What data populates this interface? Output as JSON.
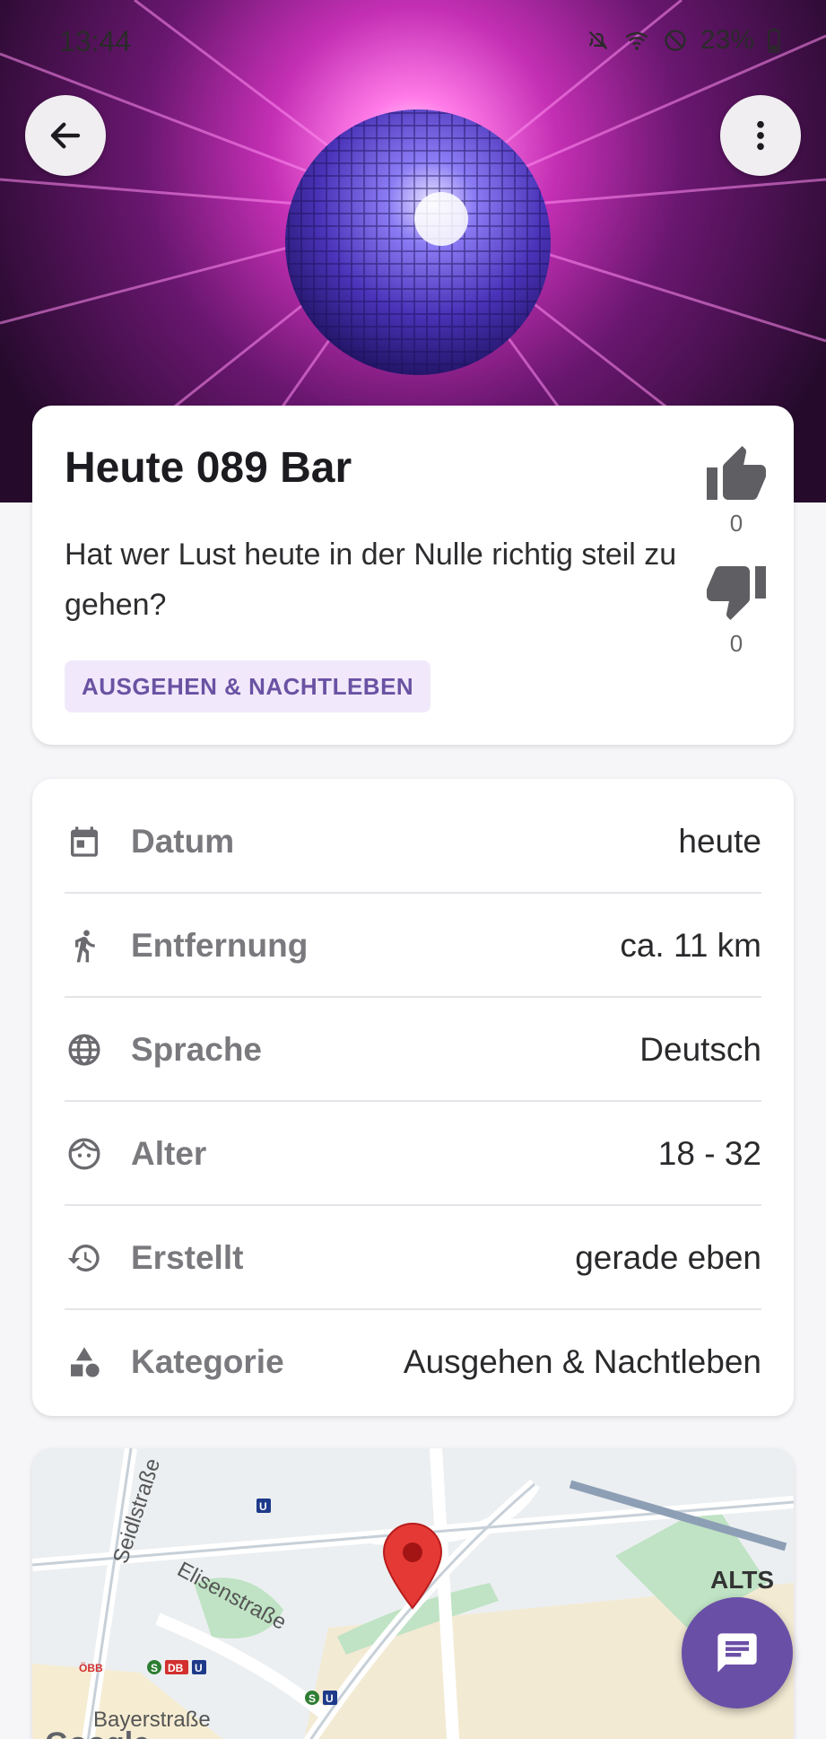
{
  "status_bar": {
    "time": "13:44",
    "battery": "23%"
  },
  "header": {
    "back_icon": "arrow-back-icon",
    "menu_icon": "more-vert-icon"
  },
  "event": {
    "title": "Heute 089 Bar",
    "description": "Hat wer Lust heute in der Nulle richtig steil zu gehen?",
    "category_chip": "AUSGEHEN & NACHTLEBEN",
    "likes": "0",
    "dislikes": "0"
  },
  "details": [
    {
      "icon": "calendar-icon",
      "label": "Datum",
      "value": "heute"
    },
    {
      "icon": "walk-icon",
      "label": "Entfernung",
      "value": "ca. 11 km"
    },
    {
      "icon": "globe-icon",
      "label": "Sprache",
      "value": "Deutsch"
    },
    {
      "icon": "face-icon",
      "label": "Alter",
      "value": "18 - 32"
    },
    {
      "icon": "history-icon",
      "label": "Erstellt",
      "value": "gerade eben"
    },
    {
      "icon": "category-icon",
      "label": "Kategorie",
      "value": "Ausgehen & Nachtleben"
    }
  ],
  "map": {
    "streets": [
      "Seidlstraße",
      "Elisenstraße",
      "Bayerstraße",
      "ALTS"
    ],
    "transit": [
      "U",
      "ÖBB",
      "S",
      "DB",
      "U",
      "S",
      "U"
    ],
    "logo": "Google"
  },
  "colors": {
    "accent": "#6a4fa7",
    "chip_bg": "#f1e9fb",
    "pin": "#e53935"
  }
}
